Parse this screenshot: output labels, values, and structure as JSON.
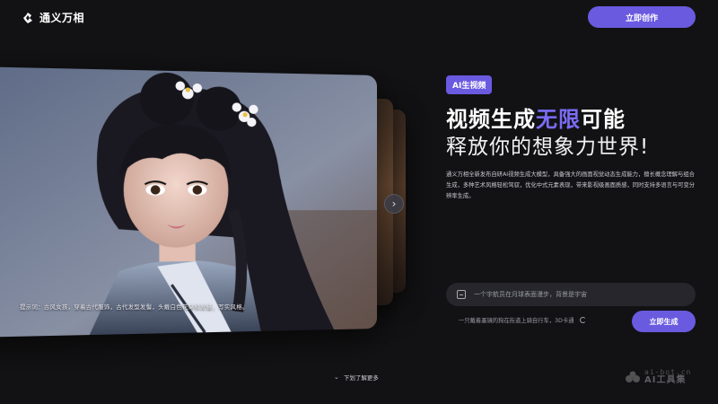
{
  "header": {
    "brand": "通义万相",
    "create_button": "立即创作"
  },
  "carousel": {
    "caption": "提示词：古风女孩，穿着古代服饰，古代发型发髻，头戴白色花朵和发簪，写实风格。"
  },
  "hero": {
    "tag": "AI生视频",
    "headline_part1": "视频生成",
    "headline_accent": "无限",
    "headline_part2": "可能",
    "subheadline": "释放你的想象力世界!",
    "description": "通义万相全新发布自研AI视频生成大模型，具备强大的画面视觉动态生成能力，擅长概念理解与组合生成，多种艺术风格轻松驾驭，优化中式元素表现，带来影视级画面质感，同时支持多语言与可变分辨率生成。"
  },
  "prompt": {
    "placeholder": "一个宇航员在月球表面漫步，背景是宇宙",
    "suggestion": "一只戴着墨镜的狗在街道上骑自行车，3D卡通",
    "generate_button": "立即生成"
  },
  "footer": {
    "scroll_hint": "下划了解更多",
    "watermark_top": "ai-bot.cn",
    "watermark_bottom": "AI工具集"
  },
  "colors": {
    "accent": "#6a5ae0",
    "accent_text": "#7b6cf6",
    "background": "#121214"
  }
}
